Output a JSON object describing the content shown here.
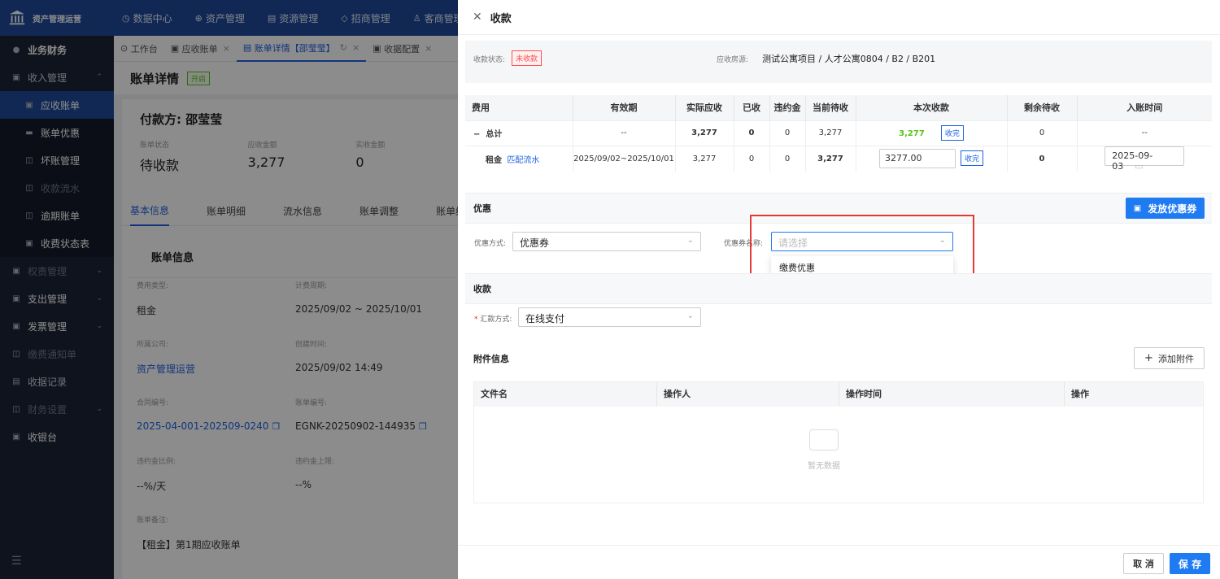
{
  "app": {
    "logo_text": "资产管理运营"
  },
  "topnav": [
    {
      "icon": "◷",
      "label": "数据中心"
    },
    {
      "icon": "⊕",
      "label": "资产管理"
    },
    {
      "icon": "▤",
      "label": "资源管理"
    },
    {
      "icon": "◇",
      "label": "招商管理"
    },
    {
      "icon": "♙",
      "label": "客商管理"
    }
  ],
  "sidebar": {
    "section": "业务财务",
    "items": [
      {
        "label": "收入管理",
        "icon": "▣"
      },
      {
        "label": "应收账单",
        "icon": "▣"
      },
      {
        "label": "账单优惠",
        "icon": "▬"
      },
      {
        "label": "坏账管理",
        "icon": "◫"
      },
      {
        "label": "收款流水",
        "icon": "◫"
      },
      {
        "label": "逾期账单",
        "icon": "◫"
      },
      {
        "label": "收费状态表",
        "icon": "▣"
      },
      {
        "label": "权责管理",
        "icon": "▣"
      },
      {
        "label": "支出管理",
        "icon": "▣"
      },
      {
        "label": "发票管理",
        "icon": "▣"
      },
      {
        "label": "缴费通知单",
        "icon": "◫"
      },
      {
        "label": "收据记录",
        "icon": "▤"
      },
      {
        "label": "财务设置",
        "icon": "◫"
      },
      {
        "label": "收银台",
        "icon": "▣"
      }
    ]
  },
  "tabs": [
    {
      "icon": "⊙",
      "label": "工作台"
    },
    {
      "icon": "▣",
      "label": "应收账单"
    },
    {
      "icon": "▤",
      "label": "账单详情【邵莹莹】"
    },
    {
      "icon": "▣",
      "label": "收据配置"
    }
  ],
  "page": {
    "title": "账单详情",
    "badge": "开启",
    "payer": "付款方: 邵莹莹",
    "stats": [
      {
        "label": "账单状态",
        "value": "待收款"
      },
      {
        "label": "应收金额",
        "value": "3,277"
      },
      {
        "label": "实收金额",
        "value": "0"
      }
    ],
    "sub_tabs": [
      "基本信息",
      "账单明细",
      "流水信息",
      "账单调整",
      "账单结转"
    ],
    "section_title": "账单信息",
    "info": [
      [
        {
          "label": "费用类型:",
          "value": "租金"
        },
        {
          "label": "计费周期:",
          "value": "2025/09/02 ~ 2025/10/01"
        }
      ],
      [
        {
          "label": "所属公司:",
          "value": "资产管理运营"
        },
        {
          "label": "创建时间:",
          "value": "2025/09/02 14:49"
        }
      ],
      [
        {
          "label": "合同编号:",
          "value": "2025-04-001-202509-0240"
        },
        {
          "label": "账单编号:",
          "value": "EGNK-20250902-144935"
        }
      ],
      [
        {
          "label": "违约金比例:",
          "value": "--%/天"
        },
        {
          "label": "违约金上限:",
          "value": "--%"
        }
      ],
      [
        {
          "label": "账单备注:",
          "value": "【租金】第1期应收账单"
        }
      ]
    ]
  },
  "drawer": {
    "title": "收款",
    "status_label": "收款状态:",
    "status_value": "未收款",
    "source_label": "应收房源:",
    "source_value": "测试公寓项目 / 人才公寓0804 / B2 / B201",
    "table": {
      "headers": [
        "费用",
        "有效期",
        "实际应收",
        "已收",
        "违约金",
        "当前待收",
        "本次收款",
        "剩余待收",
        "入账时间"
      ],
      "total": {
        "name": "总计",
        "period": "--",
        "actual": "3,277",
        "received": "0",
        "penalty": "0",
        "pending": "3,277",
        "this": "3,277",
        "btn": "收完",
        "remain": "0",
        "time": "--"
      },
      "row": {
        "name": "租金",
        "match": "匹配流水",
        "period": "2025/09/02~2025/10/01",
        "actual": "3,277",
        "received": "0",
        "penalty": "0",
        "pending": "3,277",
        "this": "3277.00",
        "btn": "收完",
        "remain": "0",
        "time": "2025-09-03"
      }
    },
    "discount": {
      "title": "优惠",
      "issue_btn": "发放优惠券",
      "method_label": "优惠方式:",
      "method_value": "优惠券",
      "name_label": "优惠券名称:",
      "name_placeholder": "请选择",
      "options": [
        "缴费优惠"
      ]
    },
    "payment": {
      "title": "收款",
      "method_label": "汇款方式:",
      "method_value": "在线支付"
    },
    "attach": {
      "title": "附件信息",
      "add_btn": "添加附件",
      "headers": [
        "文件名",
        "操作人",
        "操作时间",
        "操作"
      ],
      "empty": "暂无数据"
    },
    "footer": {
      "cancel": "取 消",
      "save": "保 存"
    }
  },
  "colors": {
    "primary": "#1f7bf2",
    "nav": "#1f4a9c",
    "sidebar": "#1c2335",
    "danger": "#e53935"
  }
}
